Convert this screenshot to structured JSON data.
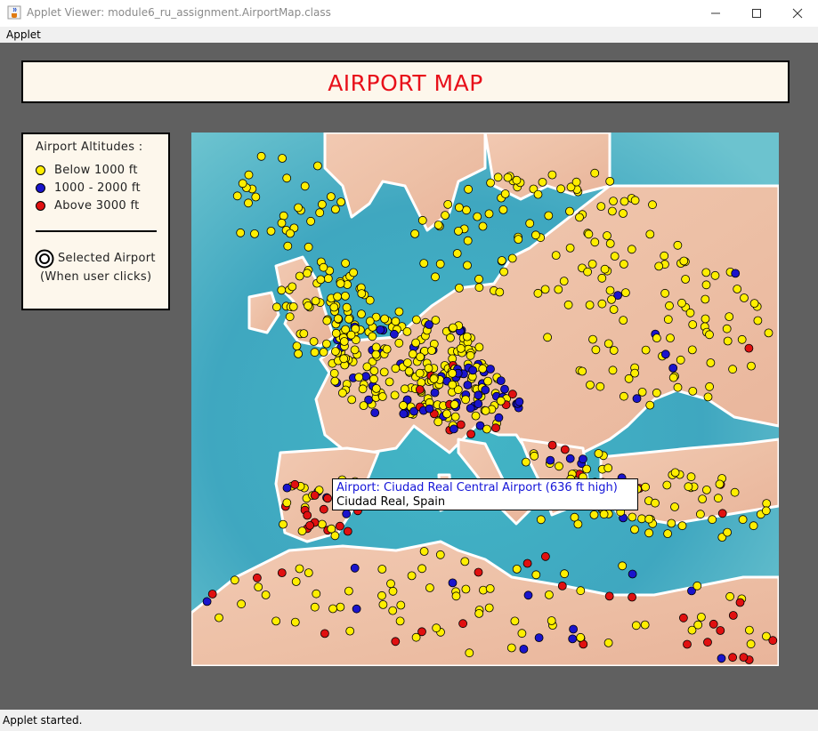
{
  "window": {
    "title": "Applet Viewer: module6_ru_assignment.AirportMap.class",
    "icon": "java-cup-icon",
    "controls": [
      "minimize-icon",
      "maximize-icon",
      "close-icon"
    ]
  },
  "menu": {
    "applet_label": "Applet"
  },
  "header": {
    "title": "AIRPORT MAP",
    "title_color": "#e8101a"
  },
  "legend": {
    "heading": "Airport Altitudes :",
    "items": [
      {
        "label": "Below 1000 ft",
        "color": "#ffee00"
      },
      {
        "label": "1000 - 2000 ft",
        "color": "#1a14cc"
      },
      {
        "label": "Above 3000 ft",
        "color": "#e01010"
      }
    ],
    "selected_label": "Selected Airport",
    "selected_sublabel": "(When user clicks)"
  },
  "map": {
    "tooltip": {
      "line1": "Airport: Ciudad Real Central Airport (636 ft high)",
      "line2": "Ciudad Real, Spain"
    }
  },
  "status": {
    "text": "Applet started."
  }
}
